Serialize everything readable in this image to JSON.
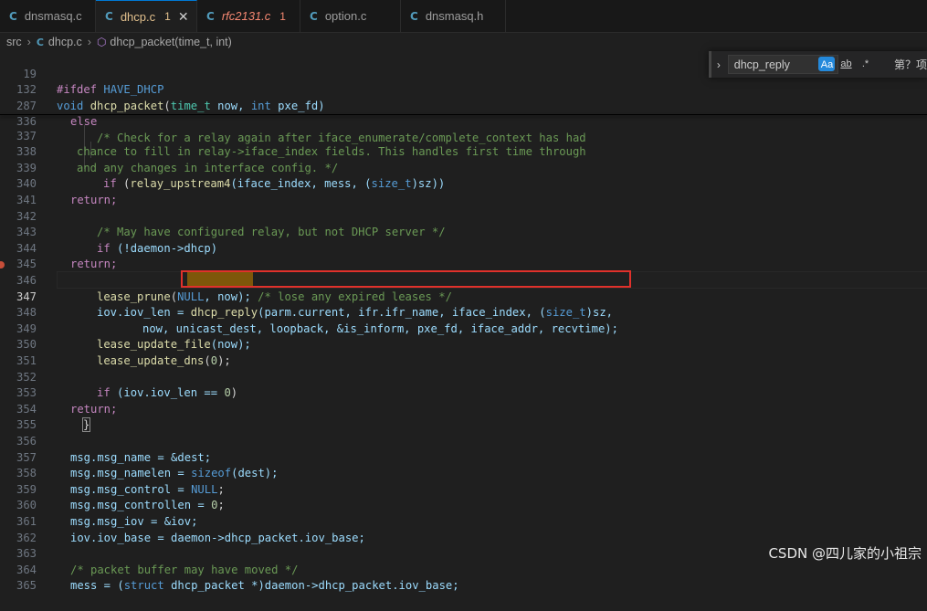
{
  "tabs": [
    {
      "label": "dnsmasq.c",
      "icon": "C",
      "active": false
    },
    {
      "label": "dhcp.c",
      "icon": "C",
      "badge": "1",
      "active": true
    },
    {
      "label": "rfc2131.c",
      "icon": "C",
      "badge": "1",
      "active": false
    },
    {
      "label": "option.c",
      "icon": "C",
      "active": false
    },
    {
      "label": "dnsmasq.h",
      "icon": "C",
      "active": false
    }
  ],
  "tab_close_glyph": "✕",
  "breadcrumb": {
    "folder": "src",
    "file_icon": "C",
    "file": "dhcp.c",
    "symbol": "dhcp_packet(time_t, int)"
  },
  "find": {
    "query": "dhcp_reply",
    "match_case": "Aa",
    "whole_word": "ab",
    "regex": ".*",
    "result": "第？项"
  },
  "watermark": "CSDN @四儿家的小祖宗",
  "lines": {
    "l19": "19",
    "l132": "132",
    "l287": "287",
    "l336": "336",
    "l337": "337",
    "l338": "338",
    "l339": "339",
    "l340": "340",
    "l341": "341",
    "l342": "342",
    "l343": "343",
    "l344": "344",
    "l345": "345",
    "l346": "346",
    "l347": "347",
    "l348": "348",
    "l349": "349",
    "l350": "350",
    "l351": "351",
    "l352": "352",
    "l353": "353",
    "l354": "354",
    "l355": "355",
    "l356": "356",
    "l357": "357",
    "l358": "358",
    "l359": "359",
    "l360": "360",
    "l361": "361",
    "l362": "362",
    "l363": "363",
    "l364": "364",
    "l365": "365"
  },
  "code": {
    "c19a": "#ifdef",
    "c19b": " HAVE_DHCP",
    "c132a": "void",
    "c132b": "dhcp_packet",
    "c132c": "(",
    "c132d": "time_t",
    "c132e": " now, ",
    "c132f": "int",
    "c132g": " pxe_fd)",
    "c287": "else",
    "c336": "/* Check for a relay again after iface_enumerate/complete_context has had",
    "c337": "chance to fill in relay->iface_index fields. This handles first time through",
    "c338": "and any changes in interface config. */",
    "c339a": "if",
    "c339b": " (",
    "c339c": "relay_upstream4",
    "c339d": "(iface_index, mess, (",
    "c339e": "size_t",
    "c339f": ")sz))",
    "c340": "return;",
    "c342": "/* May have configured relay, but not DHCP server */",
    "c343a": "if",
    "c343b": " (!daemon->dhcp)",
    "c344": "return;",
    "c346a": "lease_prune",
    "c346b": "(",
    "c346c": "NULL",
    "c346d": ", now); ",
    "c346e": "/* lose any expired leases */",
    "c347a": "iov.iov_len = ",
    "c347b": "dhcp_reply",
    "c347c": "(parm.current, ifr.ifr_name, iface_index, (",
    "c347d": "size_t",
    "c347e": ")sz,",
    "c348": "now, unicast_dest, loopback, &is_inform, pxe_fd, iface_addr, recvtime);",
    "c349a": "lease_update_file",
    "c349b": "(now);",
    "c350a": "lease_update_dns",
    "c350b": "(",
    "c350c": "0",
    "c350d": ");",
    "c352a": "if",
    "c352b": " (iov.iov_len == ",
    "c352c": "0",
    "c352d": ")",
    "c353": "return;",
    "c354": "}",
    "c356": "msg.msg_name = &dest;",
    "c357a": "msg.msg_namelen = ",
    "c357b": "sizeof",
    "c357c": "(dest);",
    "c358a": "msg.msg_control = ",
    "c358b": "NULL",
    "c358c": ";",
    "c359a": "msg.msg_controllen = ",
    "c359b": "0",
    "c359c": ";",
    "c360": "msg.msg_iov = &iov;",
    "c361": "iov.iov_base = daemon->dhcp_packet.iov_base;",
    "c363": "/* packet buffer may have moved */",
    "c364a": "mess = (",
    "c364b": "struct",
    "c364c": " dhcp_packet *)daemon->dhcp_packet.iov_base;"
  },
  "colors": {
    "keyword": "#569cd6",
    "control": "#c586c0",
    "function": "#dcdcaa",
    "comment": "#6a9955",
    "number": "#b5cea8",
    "type": "#4ec9b0",
    "highlight_box": "#e0312b"
  }
}
